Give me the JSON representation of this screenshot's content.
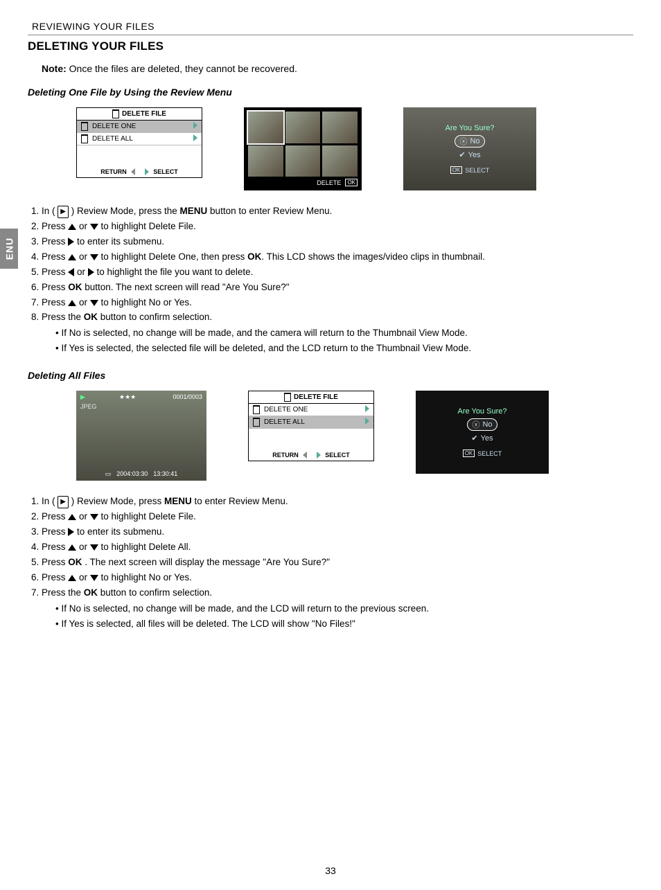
{
  "breadcrumb": "REVIEWING YOUR FILES",
  "heading": "DELETING YOUR FILES",
  "note_label": "Note:",
  "note_text": " Once the files are deleted, they cannot be recovered.",
  "side_tab": "ENU",
  "section1": {
    "title": "Deleting One File by Using the Review Menu",
    "menu_title": "DELETE FILE",
    "menu_items": [
      "DELETE ONE",
      "DELETE ALL"
    ],
    "menu_return": "RETURN",
    "menu_select": "SELECT",
    "thumb_delete": "DELETE",
    "confirm_q": "Are You Sure?",
    "confirm_no": "No",
    "confirm_yes": "Yes",
    "confirm_select": "SELECT",
    "steps": [
      {
        "pre": "In ( ",
        "post": " ) Review Mode, press the ",
        "bold": "MENU",
        "tail": " button to enter Review Menu.",
        "icon": "play"
      },
      {
        "pre": "Press ",
        "mid": "  or  ",
        "post": "  to highlight Delete File.",
        "icons": "updn"
      },
      {
        "pre": "Press ",
        "post": " to enter its submenu.",
        "icons": "rt"
      },
      {
        "pre": "Press ",
        "mid": "  or ",
        "post": "  to highlight Delete One, then press ",
        "bold": "OK",
        "tail": ". This LCD shows the images/video clips in thumbnail.",
        "icons": "updn"
      },
      {
        "pre": "Press ",
        "mid": "  or  ",
        "post": "  to highlight the file you want to delete.",
        "icons": "ltrt"
      },
      {
        "pre": "Press ",
        "bold": "OK",
        "tail": " button.  The next screen will read \"Are You Sure?\""
      },
      {
        "pre": "Press ",
        "mid": "  or ",
        "post": "  to highlight No or Yes.",
        "icons": "updn"
      },
      {
        "pre": "Press the ",
        "bold": "OK",
        "tail": " button to confirm selection."
      }
    ],
    "bullets": [
      "If No is selected, no change will be made, and the camera will return to the Thumbnail View Mode.",
      "If Yes is selected, the selected file will be deleted, and the LCD return to the Thumbnail View Mode."
    ]
  },
  "section2": {
    "title": "Deleting All Files",
    "preview_counter": "0001/0003",
    "preview_format": "JPEG",
    "preview_stars": "★★★",
    "preview_date": "2004:03:30",
    "preview_time": "13:30:41",
    "menu_title": "DELETE FILE",
    "menu_items": [
      "DELETE ONE",
      "DELETE ALL"
    ],
    "menu_return": "RETURN",
    "menu_select": "SELECT",
    "confirm_q": "Are You Sure?",
    "confirm_no": "No",
    "confirm_yes": "Yes",
    "confirm_select": "SELECT",
    "steps": [
      {
        "pre": "In ( ",
        "post": " ) Review Mode, press ",
        "bold": "MENU",
        "tail": " to enter Review Menu.",
        "icon": "play"
      },
      {
        "pre": "Press ",
        "mid": "  or  ",
        "post": " to highlight Delete File.",
        "icons": "updn"
      },
      {
        "pre": "Press  ",
        "post": " to enter its submenu.",
        "icons": "rt"
      },
      {
        "pre": "Press ",
        "mid": " or ",
        "post": "  to highlight Delete All.",
        "icons": "updn"
      },
      {
        "pre": "Press  ",
        "bold": "OK",
        "tail": " . The next screen will display the message \"Are You Sure?\""
      },
      {
        "pre": "Press ",
        "mid": " or ",
        "post": "  to highlight No or Yes.",
        "icons": "updn"
      },
      {
        "pre": "Press the ",
        "bold": "OK",
        "tail": " button to confirm selection."
      }
    ],
    "bullets": [
      "If No is selected, no change will be made, and the LCD will return to the previous screen.",
      "If Yes is selected, all files will be deleted. The LCD will show \"No Files!\""
    ]
  },
  "page_number": "33",
  "ok_label": "OK"
}
